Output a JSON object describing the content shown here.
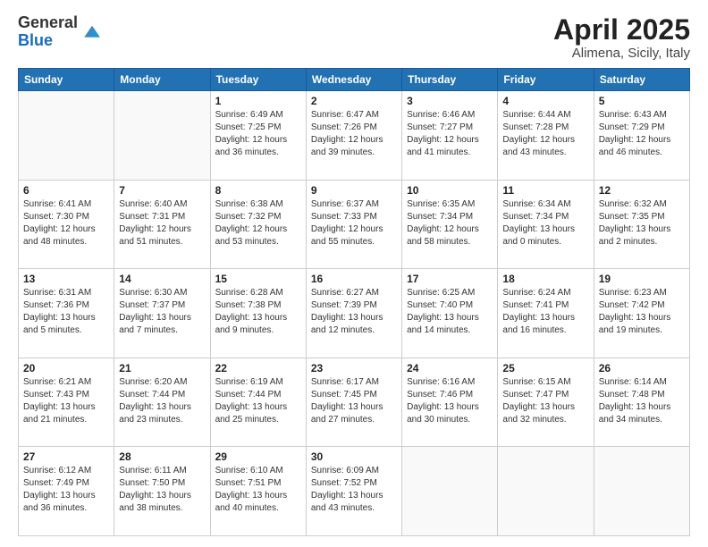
{
  "logo": {
    "general": "General",
    "blue": "Blue"
  },
  "header": {
    "title": "April 2025",
    "subtitle": "Alimena, Sicily, Italy"
  },
  "weekdays": [
    "Sunday",
    "Monday",
    "Tuesday",
    "Wednesday",
    "Thursday",
    "Friday",
    "Saturday"
  ],
  "weeks": [
    [
      {
        "day": "",
        "info": ""
      },
      {
        "day": "",
        "info": ""
      },
      {
        "day": "1",
        "info": "Sunrise: 6:49 AM\nSunset: 7:25 PM\nDaylight: 12 hours and 36 minutes."
      },
      {
        "day": "2",
        "info": "Sunrise: 6:47 AM\nSunset: 7:26 PM\nDaylight: 12 hours and 39 minutes."
      },
      {
        "day": "3",
        "info": "Sunrise: 6:46 AM\nSunset: 7:27 PM\nDaylight: 12 hours and 41 minutes."
      },
      {
        "day": "4",
        "info": "Sunrise: 6:44 AM\nSunset: 7:28 PM\nDaylight: 12 hours and 43 minutes."
      },
      {
        "day": "5",
        "info": "Sunrise: 6:43 AM\nSunset: 7:29 PM\nDaylight: 12 hours and 46 minutes."
      }
    ],
    [
      {
        "day": "6",
        "info": "Sunrise: 6:41 AM\nSunset: 7:30 PM\nDaylight: 12 hours and 48 minutes."
      },
      {
        "day": "7",
        "info": "Sunrise: 6:40 AM\nSunset: 7:31 PM\nDaylight: 12 hours and 51 minutes."
      },
      {
        "day": "8",
        "info": "Sunrise: 6:38 AM\nSunset: 7:32 PM\nDaylight: 12 hours and 53 minutes."
      },
      {
        "day": "9",
        "info": "Sunrise: 6:37 AM\nSunset: 7:33 PM\nDaylight: 12 hours and 55 minutes."
      },
      {
        "day": "10",
        "info": "Sunrise: 6:35 AM\nSunset: 7:34 PM\nDaylight: 12 hours and 58 minutes."
      },
      {
        "day": "11",
        "info": "Sunrise: 6:34 AM\nSunset: 7:34 PM\nDaylight: 13 hours and 0 minutes."
      },
      {
        "day": "12",
        "info": "Sunrise: 6:32 AM\nSunset: 7:35 PM\nDaylight: 13 hours and 2 minutes."
      }
    ],
    [
      {
        "day": "13",
        "info": "Sunrise: 6:31 AM\nSunset: 7:36 PM\nDaylight: 13 hours and 5 minutes."
      },
      {
        "day": "14",
        "info": "Sunrise: 6:30 AM\nSunset: 7:37 PM\nDaylight: 13 hours and 7 minutes."
      },
      {
        "day": "15",
        "info": "Sunrise: 6:28 AM\nSunset: 7:38 PM\nDaylight: 13 hours and 9 minutes."
      },
      {
        "day": "16",
        "info": "Sunrise: 6:27 AM\nSunset: 7:39 PM\nDaylight: 13 hours and 12 minutes."
      },
      {
        "day": "17",
        "info": "Sunrise: 6:25 AM\nSunset: 7:40 PM\nDaylight: 13 hours and 14 minutes."
      },
      {
        "day": "18",
        "info": "Sunrise: 6:24 AM\nSunset: 7:41 PM\nDaylight: 13 hours and 16 minutes."
      },
      {
        "day": "19",
        "info": "Sunrise: 6:23 AM\nSunset: 7:42 PM\nDaylight: 13 hours and 19 minutes."
      }
    ],
    [
      {
        "day": "20",
        "info": "Sunrise: 6:21 AM\nSunset: 7:43 PM\nDaylight: 13 hours and 21 minutes."
      },
      {
        "day": "21",
        "info": "Sunrise: 6:20 AM\nSunset: 7:44 PM\nDaylight: 13 hours and 23 minutes."
      },
      {
        "day": "22",
        "info": "Sunrise: 6:19 AM\nSunset: 7:44 PM\nDaylight: 13 hours and 25 minutes."
      },
      {
        "day": "23",
        "info": "Sunrise: 6:17 AM\nSunset: 7:45 PM\nDaylight: 13 hours and 27 minutes."
      },
      {
        "day": "24",
        "info": "Sunrise: 6:16 AM\nSunset: 7:46 PM\nDaylight: 13 hours and 30 minutes."
      },
      {
        "day": "25",
        "info": "Sunrise: 6:15 AM\nSunset: 7:47 PM\nDaylight: 13 hours and 32 minutes."
      },
      {
        "day": "26",
        "info": "Sunrise: 6:14 AM\nSunset: 7:48 PM\nDaylight: 13 hours and 34 minutes."
      }
    ],
    [
      {
        "day": "27",
        "info": "Sunrise: 6:12 AM\nSunset: 7:49 PM\nDaylight: 13 hours and 36 minutes."
      },
      {
        "day": "28",
        "info": "Sunrise: 6:11 AM\nSunset: 7:50 PM\nDaylight: 13 hours and 38 minutes."
      },
      {
        "day": "29",
        "info": "Sunrise: 6:10 AM\nSunset: 7:51 PM\nDaylight: 13 hours and 40 minutes."
      },
      {
        "day": "30",
        "info": "Sunrise: 6:09 AM\nSunset: 7:52 PM\nDaylight: 13 hours and 43 minutes."
      },
      {
        "day": "",
        "info": ""
      },
      {
        "day": "",
        "info": ""
      },
      {
        "day": "",
        "info": ""
      }
    ]
  ]
}
